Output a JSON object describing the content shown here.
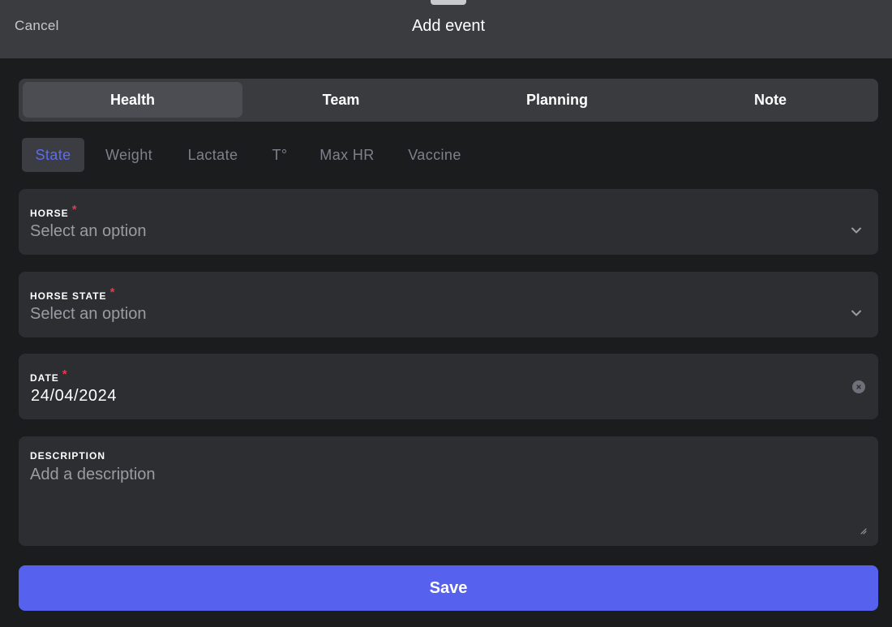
{
  "header": {
    "cancel_label": "Cancel",
    "title": "Add event"
  },
  "segments": [
    {
      "label": "Health",
      "active": true
    },
    {
      "label": "Team",
      "active": false
    },
    {
      "label": "Planning",
      "active": false
    },
    {
      "label": "Note",
      "active": false
    }
  ],
  "subtabs": [
    {
      "label": "State",
      "active": true
    },
    {
      "label": "Weight",
      "active": false
    },
    {
      "label": "Lactate",
      "active": false
    },
    {
      "label": "T°",
      "active": false
    },
    {
      "label": "Max HR",
      "active": false
    },
    {
      "label": "Vaccine",
      "active": false
    }
  ],
  "form": {
    "required_mark": "*",
    "horse": {
      "label": "HORSE",
      "placeholder": "Select an option"
    },
    "horse_state": {
      "label": "HORSE STATE",
      "placeholder": "Select an option"
    },
    "date": {
      "label": "DATE",
      "value": "24/04/2024"
    },
    "description": {
      "label": "DESCRIPTION",
      "placeholder": "Add a description"
    }
  },
  "save_label": "Save",
  "colors": {
    "accent": "#5661ee",
    "active_subtab_text": "#5c6cf0",
    "required": "#e5394c"
  },
  "icons": {
    "select_chevron": "chevron-down-icon",
    "date_clear": "clear-icon",
    "textarea_resize": "resize-handle-icon"
  }
}
